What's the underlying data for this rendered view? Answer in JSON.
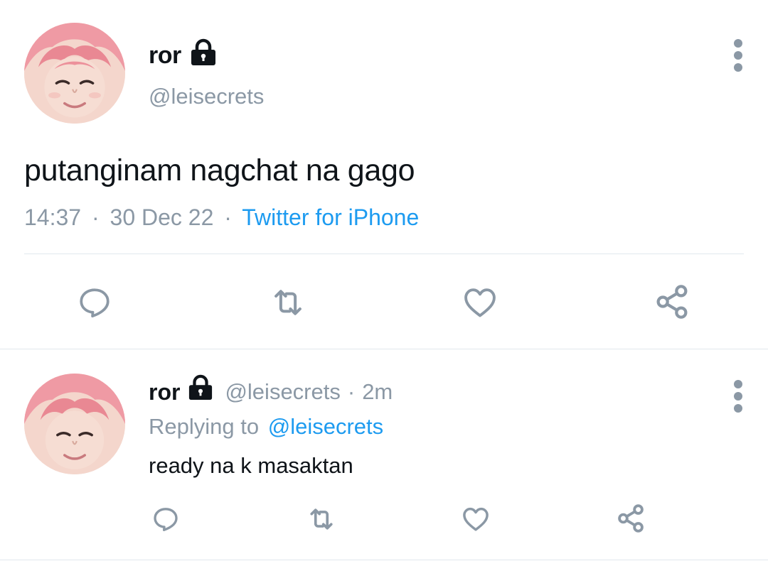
{
  "tweet": {
    "display_name": "ror",
    "handle": "@leisecrets",
    "text": "putanginam nagchat na gago",
    "time": "14:37",
    "separator_1": "·",
    "date": "30 Dec 22",
    "separator_2": "·",
    "source": "Twitter for iPhone",
    "actions": [
      "reply-icon",
      "retweet-icon",
      "like-icon",
      "share-icon"
    ]
  },
  "reply": {
    "display_name": "ror",
    "handle": "@leisecrets",
    "separator": "·",
    "age": "2m",
    "replying_prefix": "Replying to",
    "replying_to": "@leisecrets",
    "text": "ready na k masaktan",
    "actions": [
      "reply-icon",
      "retweet-icon",
      "like-icon",
      "share-icon"
    ]
  },
  "colors": {
    "link": "#1d9bf0",
    "secondary": "#8b98a5",
    "text": "#0f1419",
    "icon": "#8b98a5",
    "divider": "#e1e8ed"
  }
}
